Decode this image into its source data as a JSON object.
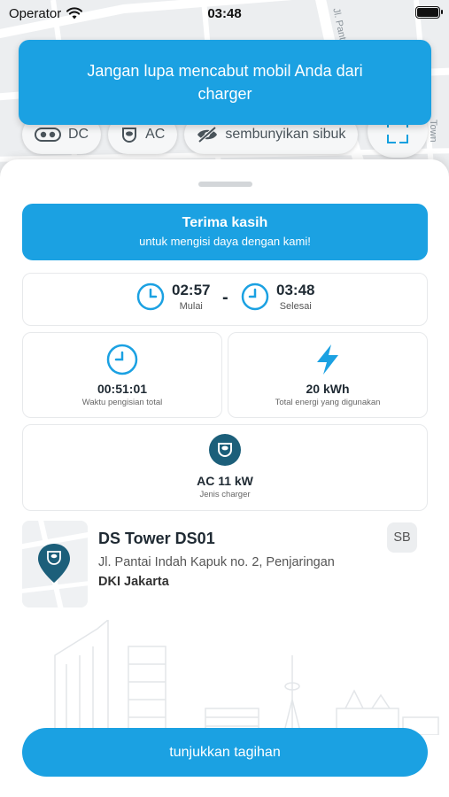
{
  "status_bar": {
    "carrier": "Operator",
    "time": "03:48"
  },
  "map": {
    "street_1": "Jl. Panta",
    "street_2": "Town"
  },
  "toast": {
    "message": "Jangan lupa mencabut mobil Anda dari charger"
  },
  "filters": {
    "dc_label": "DC",
    "ac_label": "AC",
    "hide_busy_label": "sembunyikan sibuk"
  },
  "thanks_banner": {
    "title": "Terima kasih",
    "subtitle": "untuk mengisi daya dengan kami!"
  },
  "session": {
    "start_time": "02:57",
    "start_label": "Mulai",
    "separator": "-",
    "end_time": "03:48",
    "end_label": "Selesai",
    "duration_value": "00:51:01",
    "duration_label": "Waktu pengisian total",
    "energy_value": "20 kWh",
    "energy_label": "Total energi yang digunakan",
    "charger_type_value": "AC 11 kW",
    "charger_type_label": "Jenis charger"
  },
  "station": {
    "name": "DS Tower DS01",
    "address": "Jl. Pantai Indah Kapuk no. 2, Penjaringan",
    "city": "DKI Jakarta",
    "badge": "SB"
  },
  "actions": {
    "show_bill_label": "tunjukkan tagihan"
  },
  "colors": {
    "accent": "#1ba1e2",
    "dark_teal": "#1c5f7a"
  },
  "icons": [
    "wifi-icon",
    "battery-icon",
    "dc-plug-icon",
    "ac-plug-icon",
    "eye-off-icon",
    "scan-icon",
    "clock-icon",
    "lightning-icon",
    "map-pin-icon"
  ]
}
